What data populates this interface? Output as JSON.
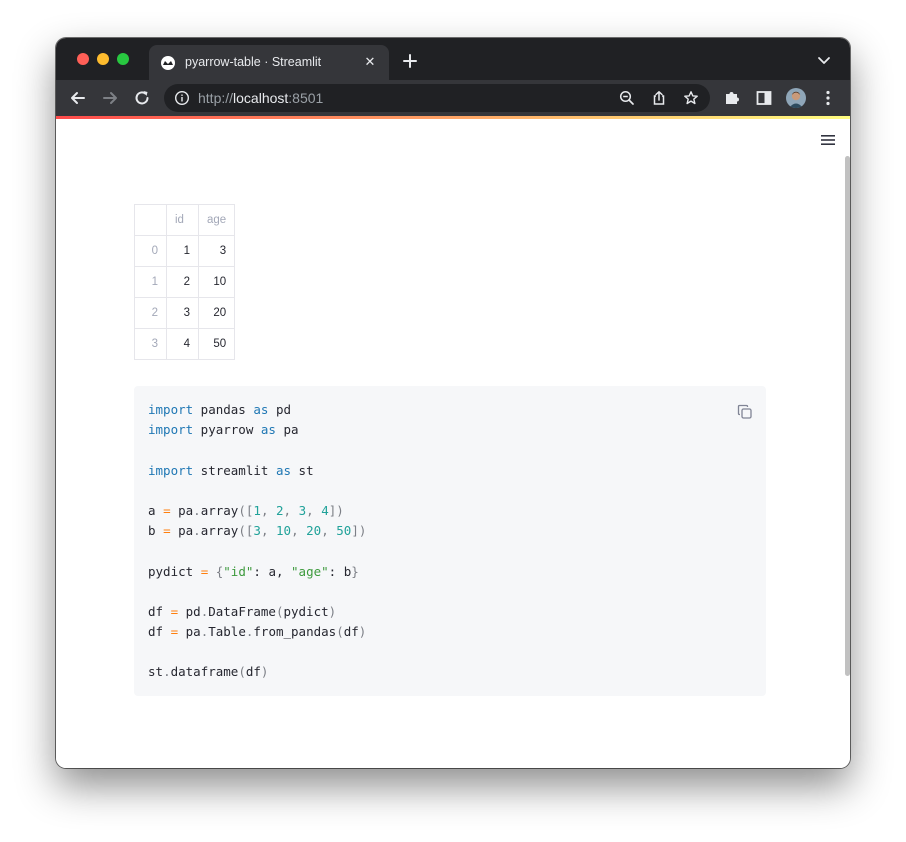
{
  "browser": {
    "tab_title": "pyarrow-table · Streamlit",
    "tab_close": "✕",
    "url_scheme": "http://",
    "url_host": "localhost",
    "url_port": ":8501"
  },
  "dataframe": {
    "columns": [
      "",
      "id",
      "age"
    ],
    "rows": [
      {
        "index": "0",
        "id": "1",
        "age": "3"
      },
      {
        "index": "1",
        "id": "2",
        "age": "10"
      },
      {
        "index": "2",
        "id": "3",
        "age": "20"
      },
      {
        "index": "3",
        "id": "4",
        "age": "50"
      }
    ]
  },
  "code": {
    "lines": [
      [
        {
          "t": "import",
          "c": "kw"
        },
        {
          "t": " pandas "
        },
        {
          "t": "as",
          "c": "kw"
        },
        {
          "t": " pd"
        }
      ],
      [
        {
          "t": "import",
          "c": "kw"
        },
        {
          "t": " pyarrow "
        },
        {
          "t": "as",
          "c": "kw"
        },
        {
          "t": " pa"
        }
      ],
      [],
      [
        {
          "t": "import",
          "c": "kw"
        },
        {
          "t": " streamlit "
        },
        {
          "t": "as",
          "c": "kw"
        },
        {
          "t": " st"
        }
      ],
      [],
      [
        {
          "t": "a "
        },
        {
          "t": "=",
          "c": "op"
        },
        {
          "t": " pa"
        },
        {
          "t": ".",
          "c": "pn"
        },
        {
          "t": "array"
        },
        {
          "t": "([",
          "c": "pn"
        },
        {
          "t": "1",
          "c": "nm"
        },
        {
          "t": ", ",
          "c": "pn"
        },
        {
          "t": "2",
          "c": "nm"
        },
        {
          "t": ", ",
          "c": "pn"
        },
        {
          "t": "3",
          "c": "nm"
        },
        {
          "t": ", ",
          "c": "pn"
        },
        {
          "t": "4",
          "c": "nm"
        },
        {
          "t": "])",
          "c": "pn"
        }
      ],
      [
        {
          "t": "b "
        },
        {
          "t": "=",
          "c": "op"
        },
        {
          "t": " pa"
        },
        {
          "t": ".",
          "c": "pn"
        },
        {
          "t": "array"
        },
        {
          "t": "([",
          "c": "pn"
        },
        {
          "t": "3",
          "c": "nm"
        },
        {
          "t": ", ",
          "c": "pn"
        },
        {
          "t": "10",
          "c": "nm"
        },
        {
          "t": ", ",
          "c": "pn"
        },
        {
          "t": "20",
          "c": "nm"
        },
        {
          "t": ", ",
          "c": "pn"
        },
        {
          "t": "50",
          "c": "nm"
        },
        {
          "t": "])",
          "c": "pn"
        }
      ],
      [],
      [
        {
          "t": "pydict "
        },
        {
          "t": "=",
          "c": "op"
        },
        {
          "t": " "
        },
        {
          "t": "{",
          "c": "pn"
        },
        {
          "t": "\"id\"",
          "c": "st"
        },
        {
          "t": ": a, "
        },
        {
          "t": "\"age\"",
          "c": "st"
        },
        {
          "t": ": b"
        },
        {
          "t": "}",
          "c": "pn"
        }
      ],
      [],
      [
        {
          "t": "df "
        },
        {
          "t": "=",
          "c": "op"
        },
        {
          "t": " pd"
        },
        {
          "t": ".",
          "c": "pn"
        },
        {
          "t": "DataFrame"
        },
        {
          "t": "(",
          "c": "pn"
        },
        {
          "t": "pydict"
        },
        {
          "t": ")",
          "c": "pn"
        }
      ],
      [
        {
          "t": "df "
        },
        {
          "t": "=",
          "c": "op"
        },
        {
          "t": " pa"
        },
        {
          "t": ".",
          "c": "pn"
        },
        {
          "t": "Table"
        },
        {
          "t": ".",
          "c": "pn"
        },
        {
          "t": "from_pandas"
        },
        {
          "t": "(",
          "c": "pn"
        },
        {
          "t": "df"
        },
        {
          "t": ")",
          "c": "pn"
        }
      ],
      [],
      [
        {
          "t": "st"
        },
        {
          "t": ".",
          "c": "pn"
        },
        {
          "t": "dataframe"
        },
        {
          "t": "(",
          "c": "pn"
        },
        {
          "t": "df"
        },
        {
          "t": ")",
          "c": "pn"
        }
      ]
    ]
  },
  "colors": {
    "keyword": "#1f77b4",
    "operator": "#ff7f0e",
    "number": "#21a29a",
    "string": "#3d9a3d",
    "code_background": "#f6f7f9",
    "browser_dark": "#202124"
  },
  "icons": {
    "back": "arrow-left-icon",
    "forward": "arrow-right-icon",
    "reload": "reload-icon",
    "site_info": "info-icon",
    "zoom": "zoom-out-icon",
    "share": "share-icon",
    "bookmark": "star-icon",
    "extensions": "puzzle-icon",
    "side_panel": "side-panel-icon",
    "menu": "kebab-menu-icon",
    "app_menu": "hamburger-icon",
    "copy": "copy-icon"
  }
}
